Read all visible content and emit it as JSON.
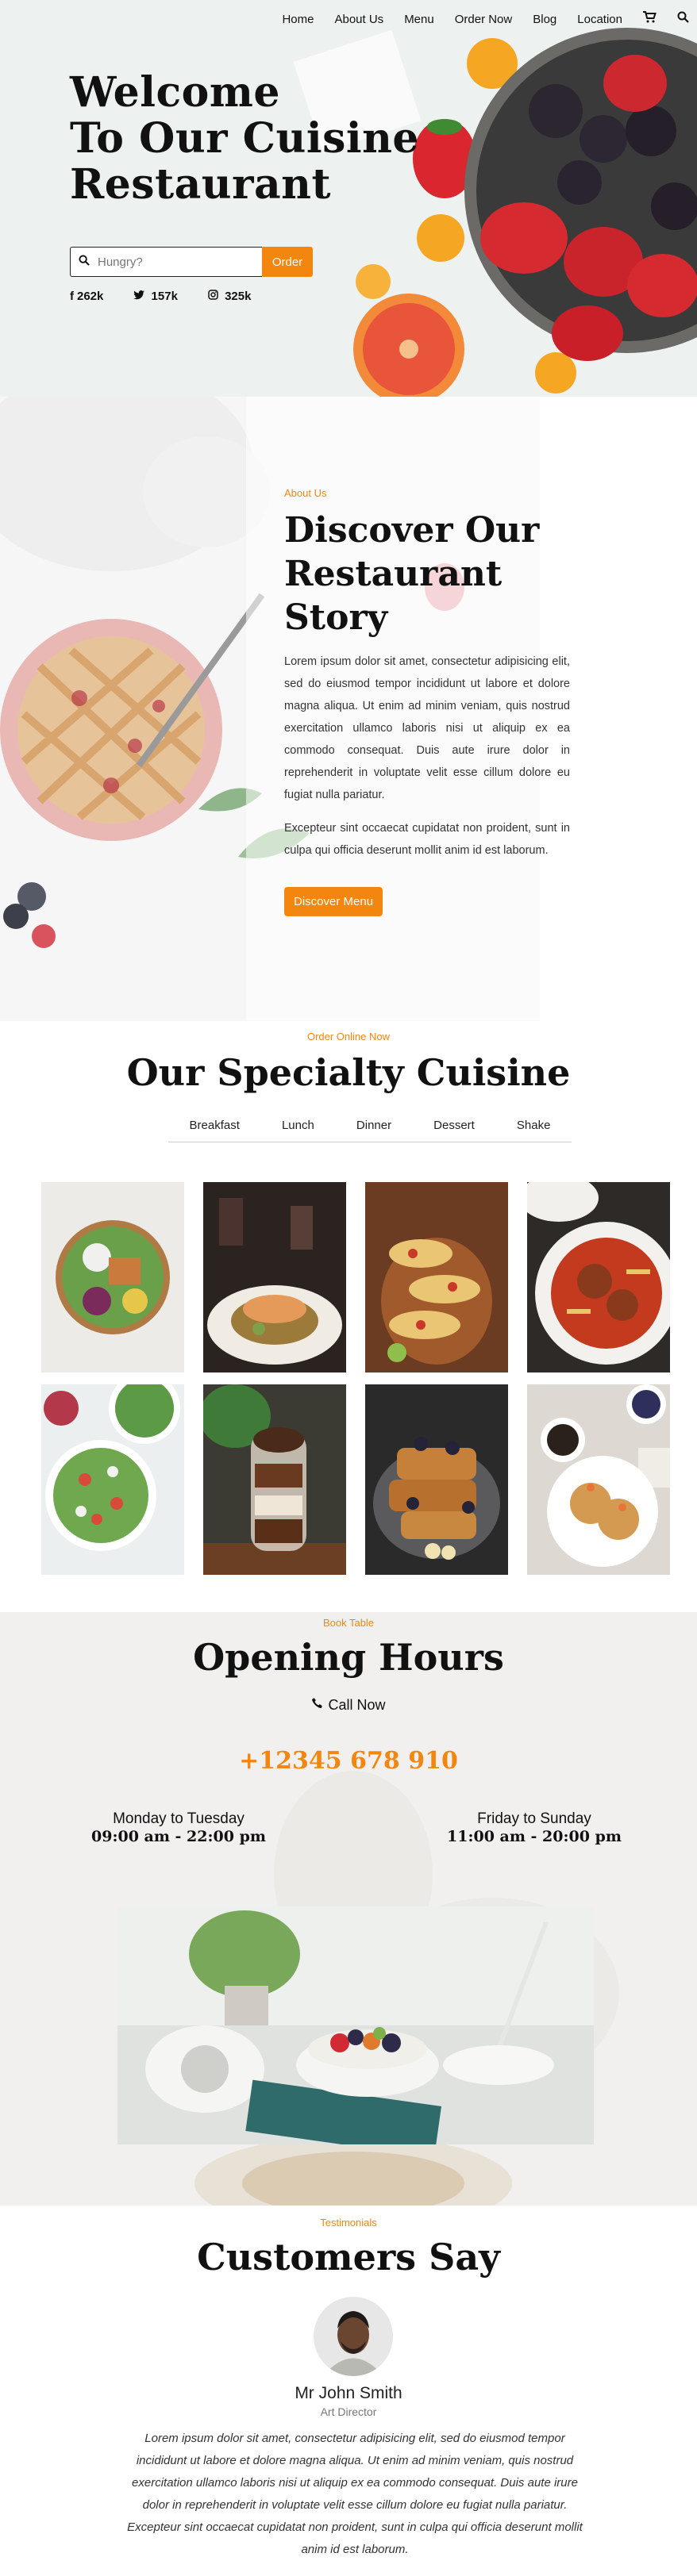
{
  "nav": {
    "items": [
      "Home",
      "About Us",
      "Menu",
      "Order Now",
      "Blog",
      "Location"
    ],
    "cart_icon": "cart-icon",
    "search_icon": "search-icon"
  },
  "hero": {
    "title_line1": "Welcome",
    "title_line2": "To Our Cuisine",
    "title_line3": "Restaurant",
    "search_placeholder": "Hungry?",
    "order_label": "Order",
    "socials": [
      {
        "icon": "facebook-icon",
        "count": "262k"
      },
      {
        "icon": "twitter-icon",
        "count": "157k"
      },
      {
        "icon": "instagram-icon",
        "count": "325k"
      }
    ]
  },
  "about": {
    "eyebrow": "About Us",
    "title_line1": "Discover Our",
    "title_line2": "Restaurant",
    "title_line3": "Story",
    "para1": "Lorem ipsum dolor sit amet, consectetur adipisicing elit, sed do eiusmod tempor incididunt ut labore et dolore magna aliqua. Ut enim ad minim veniam, quis nostrud exercitation ullamco laboris nisi ut aliquip ex ea commodo consequat. Duis aute irure dolor in reprehenderit in voluptate velit esse cillum dolore eu fugiat nulla pariatur.",
    "para2": "Excepteur sint occaecat cupidatat non proident, sunt in culpa qui officia deserunt mollit anim id est laborum.",
    "button": "Discover Menu"
  },
  "specialty": {
    "eyebrow": "Order Online Now",
    "title": "Our Specialty Cuisine",
    "tabs": [
      "Breakfast",
      "Lunch",
      "Dinner",
      "Dessert",
      "Shake"
    ]
  },
  "hours": {
    "eyebrow": "Book Table",
    "title": "Opening Hours",
    "call_label": "Call Now",
    "phone": "+12345 678 910",
    "left_days": "Monday to Tuesday",
    "left_time": "09:00 am - 22:00 pm",
    "right_days": "Friday to Sunday",
    "right_time": "11:00 am - 20:00 pm"
  },
  "testimonials": {
    "eyebrow": "Testimonials",
    "title": "Customers Say",
    "name": "Mr John Smith",
    "role": "Art Director",
    "quote": "Lorem ipsum dolor sit amet, consectetur adipisicing elit, sed do eiusmod tempor incididunt ut labore et dolore magna aliqua. Ut enim ad minim veniam, quis nostrud exercitation ullamco laboris nisi ut aliquip ex ea commodo consequat. Duis aute irure dolor in reprehenderit in voluptate velit esse cillum dolore eu fugiat nulla pariatur. Excepteur sint occaecat cupidatat non proident, sunt in culpa qui officia deserunt mollit anim id est laborum."
  },
  "colors": {
    "accent": "#f3860e",
    "text": "#111111",
    "hero_bg": "#edf2f1"
  }
}
